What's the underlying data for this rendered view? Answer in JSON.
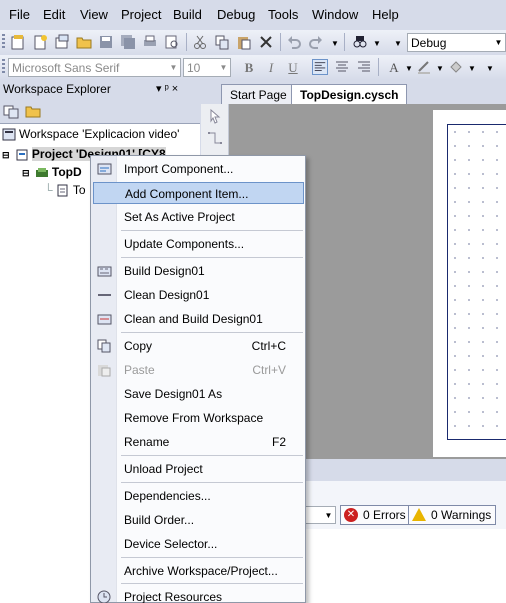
{
  "menubar": {
    "items": [
      "File",
      "Edit",
      "View",
      "Project",
      "Build",
      "Debug",
      "Tools",
      "Window",
      "Help"
    ]
  },
  "toolbar": {
    "config_value": "Debug",
    "font_name": "Microsoft Sans Serif",
    "font_size": "10"
  },
  "workspace_explorer": {
    "title": "Workspace Explorer",
    "pin_glyph": "▾ ᵖ ×",
    "tree": {
      "workspace": "Workspace 'Explicacion video'",
      "project": "Project 'Design01' [CY8",
      "schematic": "TopD",
      "file": "To"
    }
  },
  "document": {
    "tabs": [
      "Start Page",
      "TopDesign.cysch"
    ]
  },
  "output": {
    "errors": "0 Errors",
    "warnings": "0 Warnings"
  },
  "context_menu": {
    "items": [
      {
        "label": "Import Component...",
        "shortcut": "",
        "icon": "import-icon",
        "disabled": false,
        "highlighted": false
      },
      {
        "label": "Add Component Item...",
        "shortcut": "",
        "icon": "",
        "disabled": false,
        "highlighted": true
      },
      {
        "label": "Set As Active Project",
        "shortcut": "",
        "icon": "",
        "disabled": false,
        "highlighted": false
      },
      {
        "label": "Update Components...",
        "shortcut": "",
        "icon": "",
        "disabled": false,
        "highlighted": false
      },
      {
        "label": "Build Design01",
        "shortcut": "",
        "icon": "build-icon",
        "disabled": false,
        "highlighted": false
      },
      {
        "label": "Clean Design01",
        "shortcut": "",
        "icon": "clean-icon",
        "disabled": false,
        "highlighted": false
      },
      {
        "label": "Clean and Build Design01",
        "shortcut": "",
        "icon": "clean-build-icon",
        "disabled": false,
        "highlighted": false
      },
      {
        "label": "Copy",
        "shortcut": "Ctrl+C",
        "icon": "copy-icon",
        "disabled": false,
        "highlighted": false
      },
      {
        "label": "Paste",
        "shortcut": "Ctrl+V",
        "icon": "paste-icon",
        "disabled": true,
        "highlighted": false
      },
      {
        "label": "Save Design01 As",
        "shortcut": "",
        "icon": "",
        "disabled": false,
        "highlighted": false
      },
      {
        "label": "Remove From Workspace",
        "shortcut": "",
        "icon": "",
        "disabled": false,
        "highlighted": false
      },
      {
        "label": "Rename",
        "shortcut": "F2",
        "icon": "",
        "disabled": false,
        "highlighted": false
      },
      {
        "label": "Unload Project",
        "shortcut": "",
        "icon": "",
        "disabled": false,
        "highlighted": false
      },
      {
        "label": "Dependencies...",
        "shortcut": "",
        "icon": "",
        "disabled": false,
        "highlighted": false
      },
      {
        "label": "Build Order...",
        "shortcut": "",
        "icon": "",
        "disabled": false,
        "highlighted": false
      },
      {
        "label": "Device Selector...",
        "shortcut": "",
        "icon": "",
        "disabled": false,
        "highlighted": false
      },
      {
        "label": "Archive Workspace/Project...",
        "shortcut": "",
        "icon": "",
        "disabled": false,
        "highlighted": false
      },
      {
        "label": "Project Resources",
        "shortcut": "",
        "icon": "resources-icon",
        "disabled": false,
        "highlighted": false
      }
    ]
  },
  "colors": {
    "chrome": "#d6dbe9",
    "highlight": "#c1d6f2",
    "canvas_border": "#1a2a6e"
  }
}
